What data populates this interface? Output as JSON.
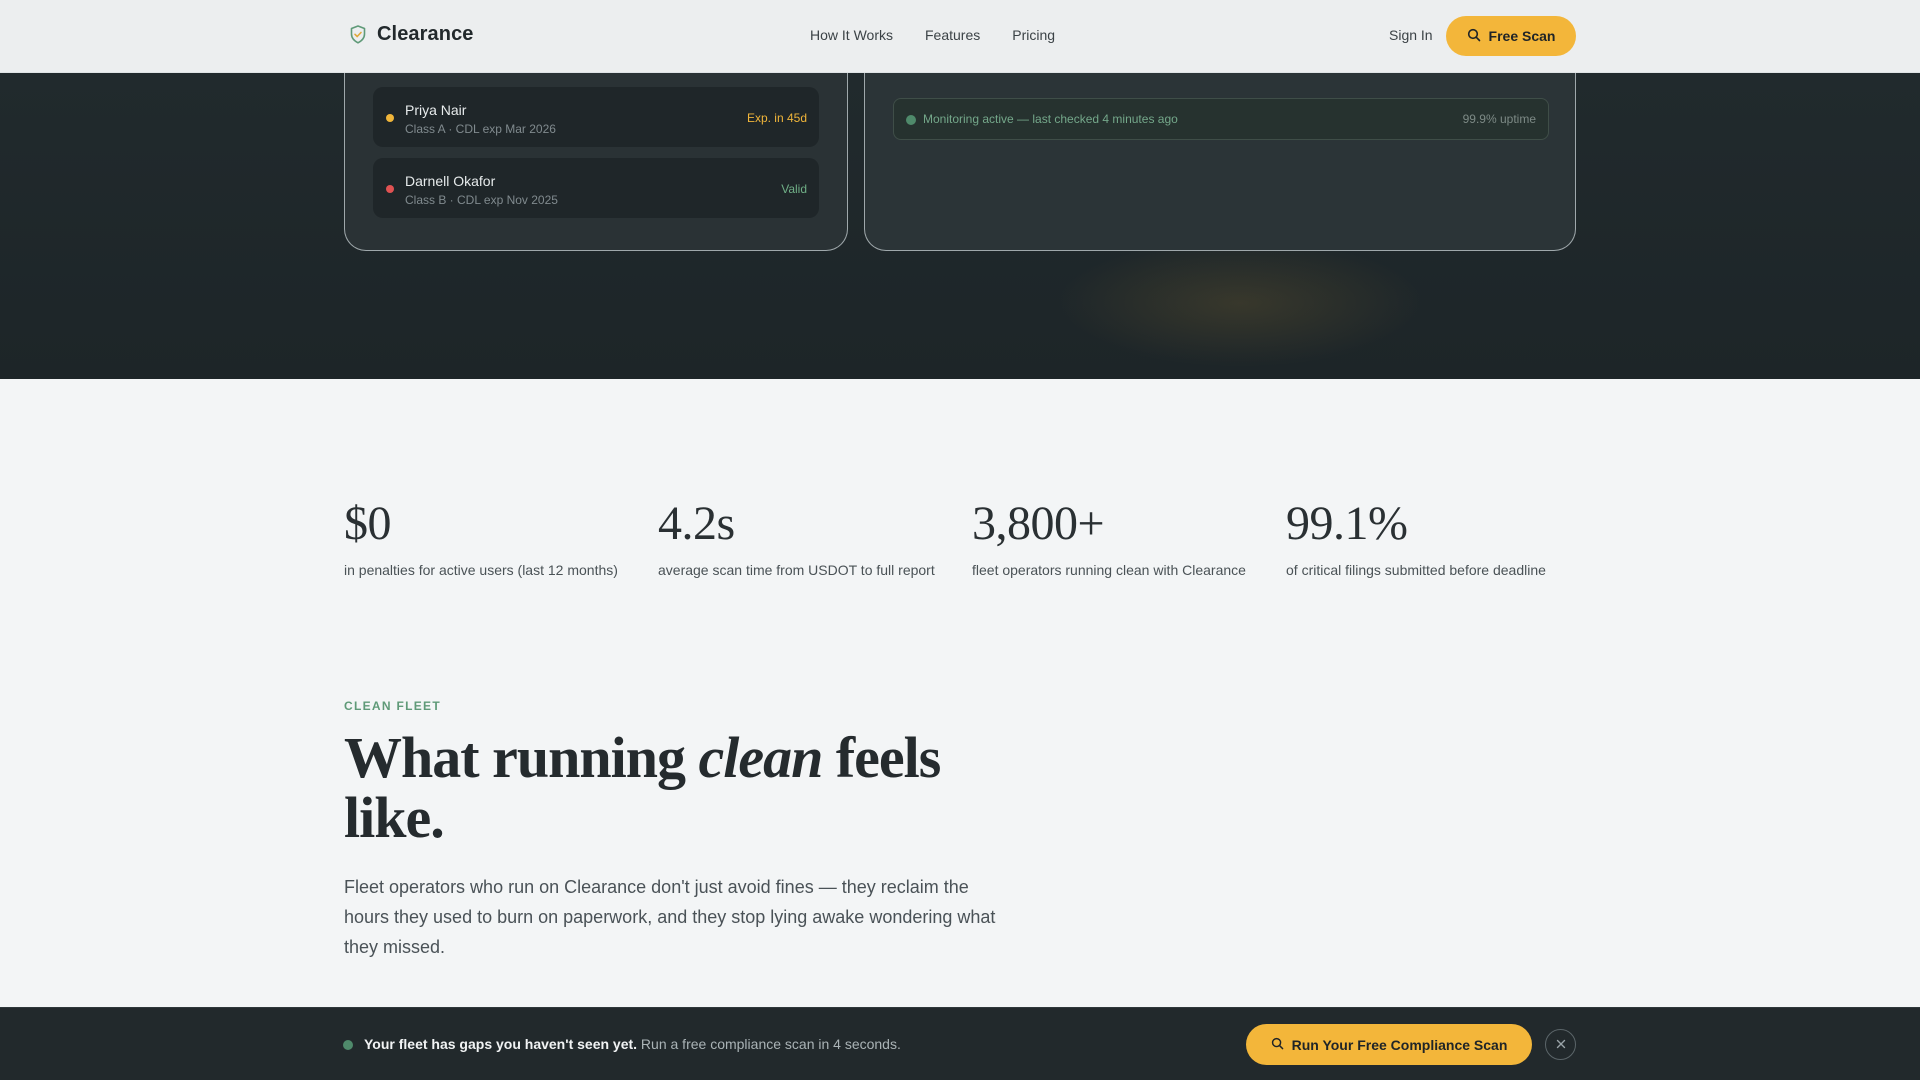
{
  "header": {
    "brand": "Clearance",
    "nav": [
      "How It Works",
      "Features",
      "Pricing"
    ],
    "sign_in": "Sign In",
    "cta": "Free Scan"
  },
  "hero": {
    "drivers": [
      {
        "name": "Priya Nair",
        "meta": "Class A · CDL exp Mar 2026",
        "status": "Exp. in 45d",
        "status_color": "#f0b53a"
      },
      {
        "name": "Darnell Okafor",
        "meta": "Class B · CDL exp Nov 2025",
        "status": "Valid",
        "status_color": "#6fae86"
      }
    ],
    "monitoring": {
      "text": "Monitoring active — last checked 4 minutes ago",
      "uptime": "99.9% uptime"
    }
  },
  "stats": [
    {
      "value": "$0",
      "label": "in penalties for active users (last 12 months)"
    },
    {
      "value": "4.2s",
      "label": "average scan time from USDOT to full report"
    },
    {
      "value": "3,800+",
      "label": "fleet operators running clean with Clearance"
    },
    {
      "value": "99.1%",
      "label": "of critical filings submitted before deadline"
    }
  ],
  "clean_fleet": {
    "eyebrow": "CLEAN FLEET",
    "headline_before": "What running ",
    "headline_em": "clean",
    "headline_after": " feels like.",
    "lead": "Fleet operators who run on Clearance don't just avoid fines — they reclaim the hours they used to burn on paperwork, and they stop lying awake wondering what they missed."
  },
  "bottom_bar": {
    "bold": "Your fleet has gaps you haven't seen yet.",
    "text": " Run a free compliance scan in 4 seconds.",
    "cta": "Run Your Free Compliance Scan"
  },
  "colors": {
    "accent": "#f3b63a",
    "green": "#5f9a78",
    "dark": "#212a2d"
  }
}
